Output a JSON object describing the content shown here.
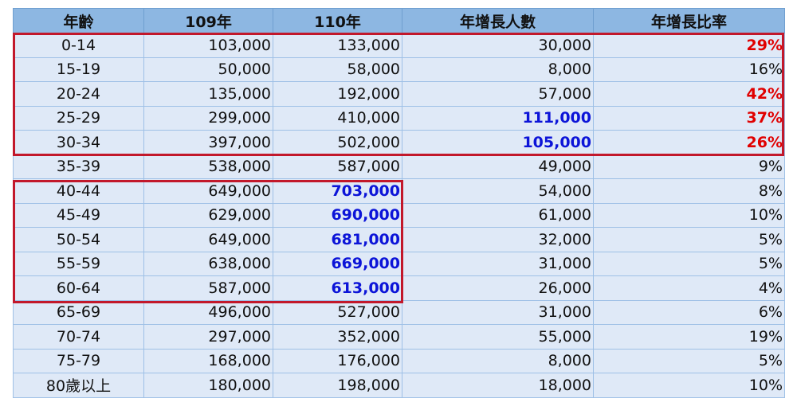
{
  "headers": [
    "年齡",
    "109年",
    "110年",
    "年增長人數",
    "年增長比率"
  ],
  "rows": [
    {
      "age": "0-14",
      "y109": "103,000",
      "y110": "133,000",
      "inc": "30,000",
      "rate": "29%"
    },
    {
      "age": "15-19",
      "y109": "50,000",
      "y110": "58,000",
      "inc": "8,000",
      "rate": "16%"
    },
    {
      "age": "20-24",
      "y109": "135,000",
      "y110": "192,000",
      "inc": "57,000",
      "rate": "42%"
    },
    {
      "age": "25-29",
      "y109": "299,000",
      "y110": "410,000",
      "inc": "111,000",
      "rate": "37%"
    },
    {
      "age": "30-34",
      "y109": "397,000",
      "y110": "502,000",
      "inc": "105,000",
      "rate": "26%"
    },
    {
      "age": "35-39",
      "y109": "538,000",
      "y110": "587,000",
      "inc": "49,000",
      "rate": "9%"
    },
    {
      "age": "40-44",
      "y109": "649,000",
      "y110": "703,000",
      "inc": "54,000",
      "rate": "8%"
    },
    {
      "age": "45-49",
      "y109": "629,000",
      "y110": "690,000",
      "inc": "61,000",
      "rate": "10%"
    },
    {
      "age": "50-54",
      "y109": "649,000",
      "y110": "681,000",
      "inc": "32,000",
      "rate": "5%"
    },
    {
      "age": "55-59",
      "y109": "638,000",
      "y110": "669,000",
      "inc": "31,000",
      "rate": "5%"
    },
    {
      "age": "60-64",
      "y109": "587,000",
      "y110": "613,000",
      "inc": "26,000",
      "rate": "4%"
    },
    {
      "age": "65-69",
      "y109": "496,000",
      "y110": "527,000",
      "inc": "31,000",
      "rate": "6%"
    },
    {
      "age": "70-74",
      "y109": "297,000",
      "y110": "352,000",
      "inc": "55,000",
      "rate": "19%"
    },
    {
      "age": "75-79",
      "y109": "168,000",
      "y110": "176,000",
      "inc": "8,000",
      "rate": "5%"
    },
    {
      "age": "80歲以上",
      "y109": "180,000",
      "y110": "198,000",
      "inc": "18,000",
      "rate": "10%"
    }
  ],
  "highlights": {
    "red_text_color": "#e00000",
    "blue_text_color": "#0c14d8",
    "box_color": "#c2182b",
    "rate_red_rows": [
      0,
      2,
      3,
      4
    ],
    "inc_blue_rows": [
      3,
      4
    ],
    "y110_blue_rows": [
      6,
      7,
      8,
      9,
      10
    ]
  }
}
